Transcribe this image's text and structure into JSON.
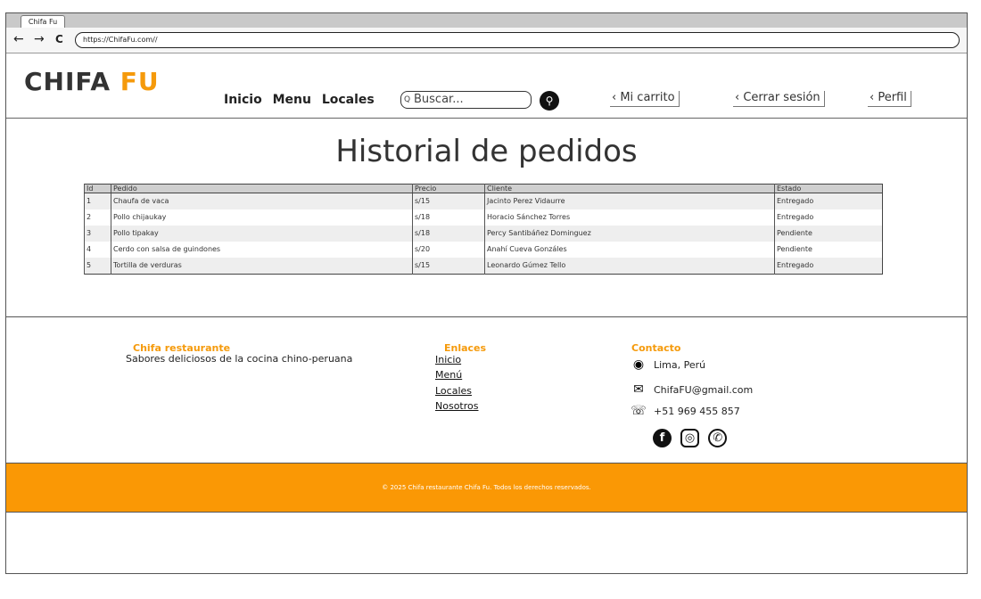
{
  "browser": {
    "tab_title": "Chifa Fu",
    "back": "←",
    "forward": "→",
    "reload": "C",
    "url": "https://ChifaFu.com//"
  },
  "header": {
    "logo_main": "CHIFA",
    "logo_accent": "FU",
    "nav": [
      "Inicio",
      "Menu",
      "Locales"
    ],
    "search_placeholder": "Buscar...",
    "search_mini_icon": "Q",
    "links": [
      "‹ Mi carrito",
      "‹ Cerrar sesión",
      "‹ Perfil"
    ]
  },
  "main": {
    "title": "Historial de pedidos",
    "columns": [
      "Id",
      "Pedido",
      "Precio",
      "Cliente",
      "Estado"
    ],
    "rows": [
      [
        "1",
        "Chaufa de vaca",
        "s/15",
        "Jacinto Perez Vidaurre",
        "Entregado"
      ],
      [
        "2",
        "Pollo chijaukay",
        "s/18",
        "Horacio Sánchez Torres",
        "Entregado"
      ],
      [
        "3",
        "Pollo tipakay",
        "s/18",
        "Percy Santibáñez Dominguez",
        "Pendiente"
      ],
      [
        "4",
        "Cerdo con salsa de guindones",
        "s/20",
        "Anahí Cueva Gonzáles",
        "Pendiente"
      ],
      [
        "5",
        "Tortilla de verduras",
        "s/15",
        "Leonardo Gúmez Tello",
        "Entregado"
      ]
    ]
  },
  "footer": {
    "brand_title": "Chifa restaurante",
    "brand_desc": "Sabores deliciosos de la cocina chino-peruana",
    "links_title": "Enlaces",
    "links": [
      "Inicio",
      "Menú",
      "Locales",
      "Nosotros"
    ],
    "contact_title": "Contacto",
    "contact": [
      {
        "icon": "location-pin-icon",
        "glyph": "⬤",
        "text": "Lima, Perú"
      },
      {
        "icon": "envelope-icon",
        "glyph": "✉",
        "text": "ChifaFU@gmail.com"
      },
      {
        "icon": "phone-icon",
        "glyph": "☏",
        "text": "+51 969 455 857"
      }
    ],
    "social": [
      {
        "name": "facebook-icon",
        "glyph": "f"
      },
      {
        "name": "instagram-icon",
        "glyph": "◎"
      },
      {
        "name": "whatsapp-icon",
        "glyph": "✆"
      }
    ],
    "copyright": "©   2025 Chifa restaurante Chifa Fu. Todos los derechos reservados."
  },
  "colors": {
    "accent": "#f59a0b",
    "footer_bar": "#fa9805",
    "header_gray": "#cfcfcf"
  }
}
